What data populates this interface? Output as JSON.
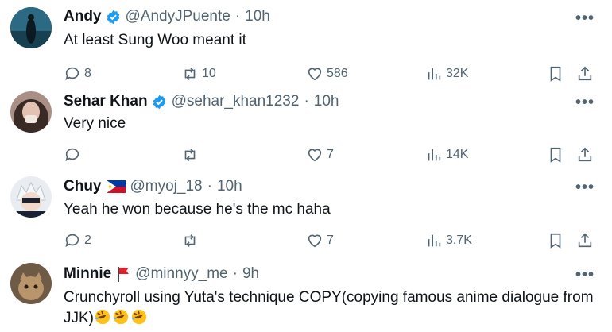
{
  "colors": {
    "verified": "#1d9bf0",
    "muted": "#536471",
    "text": "#0f1419"
  },
  "replies": [
    {
      "name": "Andy",
      "handle": "@AndyJPuente",
      "time": "10h",
      "verified": true,
      "flag": "",
      "text": "At least Sung Woo meant it",
      "counts": {
        "reply": "8",
        "retweet": "10",
        "like": "586",
        "views": "32K"
      }
    },
    {
      "name": "Sehar Khan",
      "handle": "@sehar_khan1232",
      "time": "10h",
      "verified": true,
      "flag": "",
      "text": "Very nice",
      "counts": {
        "reply": "",
        "retweet": "",
        "like": "7",
        "views": "14K"
      }
    },
    {
      "name": "Chuy",
      "handle": "@myoj_18",
      "time": "10h",
      "verified": false,
      "flag": "philippines-flag-icon",
      "text": "Yeah he won because he's the mc haha",
      "counts": {
        "reply": "2",
        "retweet": "",
        "like": "7",
        "views": "3.7K"
      }
    },
    {
      "name": "Minnie",
      "handle": "@minnyy_me",
      "time": "9h",
      "verified": false,
      "flag": "red-flag-icon",
      "text": "Crunchyroll using Yuta's technique COPY(copying famous anime dialogue from JJK)",
      "emoji": "rolling-on-floor-laughing-icon x3"
    }
  ],
  "separator": "·",
  "more_label": "•••"
}
